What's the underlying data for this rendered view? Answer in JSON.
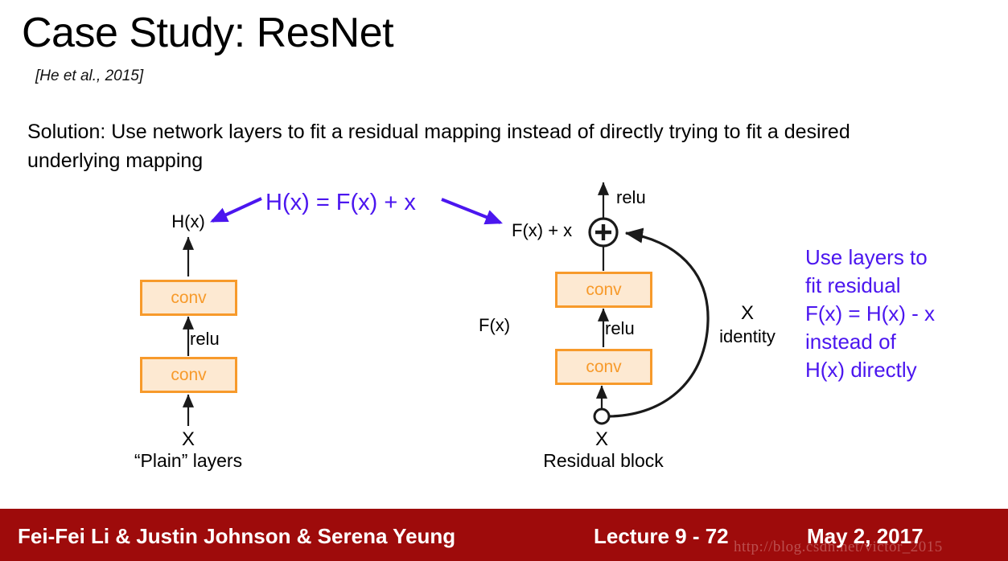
{
  "slide": {
    "title": "Case Study: ResNet",
    "citation": "[He et al., 2015]",
    "solution_text": "Solution: Use network layers to fit a residual mapping instead of directly trying to fit a desired underlying mapping"
  },
  "annotations": {
    "formula": "H(x) = F(x) + x",
    "side_note": "Use layers to\nfit residual\nF(x) = H(x) - x\ninstead of\nH(x) directly",
    "accent_color": "#4b16ef"
  },
  "plain_diagram": {
    "output_label": "H(x)",
    "top_conv": "conv",
    "relu": "relu",
    "bottom_conv": "conv",
    "input_label": "X",
    "caption": "“Plain” layers"
  },
  "residual_diagram": {
    "output_label": "F(x) + x",
    "relu_top": "relu",
    "top_conv": "conv",
    "relu_mid": "relu",
    "bottom_conv": "conv",
    "residual_fn_label": "F(x)",
    "skip_label_top": "X",
    "skip_label_bottom": "identity",
    "input_label": "X",
    "caption": "Residual block",
    "sum_node_glyph": "plus"
  },
  "style": {
    "conv_fill": "#fde9d2",
    "conv_border": "#f79a2b",
    "conv_text": "#f79a2b",
    "footer_bg": "#9e0b0b"
  },
  "footer": {
    "authors": "Fei-Fei Li & Justin Johnson & Serena Yeung",
    "lecture": "Lecture 9 - 72",
    "date": "May 2, 2017",
    "watermark": "http://blog.csdn.net/victor_2015"
  }
}
